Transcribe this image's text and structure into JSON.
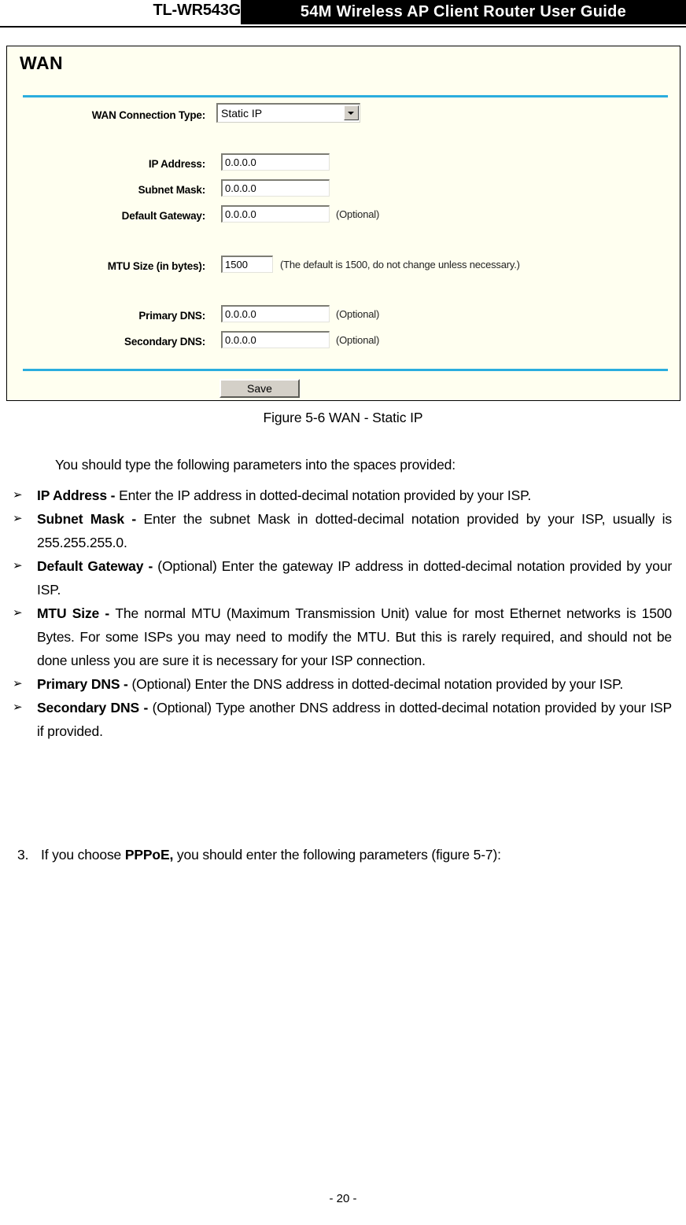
{
  "header": {
    "model": "TL-WR543G",
    "banner": "54M  Wireless  AP  Client  Router  User  Guide"
  },
  "figure": {
    "panel_title": "WAN",
    "accent_color": "#2badde",
    "panel_background": "#fffff0",
    "fields": [
      {
        "label": "WAN Connection Type:",
        "type": "select",
        "value": "Static IP",
        "hint": ""
      },
      {
        "label": "IP Address:",
        "type": "text",
        "value": "0.0.0.0",
        "hint": ""
      },
      {
        "label": "Subnet Mask:",
        "type": "text",
        "value": "0.0.0.0",
        "hint": ""
      },
      {
        "label": "Default Gateway:",
        "type": "text",
        "value": "0.0.0.0",
        "hint": "(Optional)"
      },
      {
        "label": "MTU Size (in bytes):",
        "type": "text",
        "value": "1500",
        "hint": "(The default is 1500, do not change unless necessary.)"
      },
      {
        "label": "Primary DNS:",
        "type": "text",
        "value": "0.0.0.0",
        "hint": "(Optional)"
      },
      {
        "label": "Secondary DNS:",
        "type": "text",
        "value": "0.0.0.0",
        "hint": "(Optional)"
      }
    ],
    "save_button": "Save",
    "caption": "Figure 5-6    WAN - Static IP"
  },
  "body": {
    "intro": "You should type the following parameters into the spaces provided:",
    "bullet_marker": "➢",
    "bullets": [
      {
        "term": "IP Address - ",
        "text": "Enter the IP address in dotted-decimal notation provided by your ISP."
      },
      {
        "term": "Subnet Mask - ",
        "text": "Enter the subnet Mask in dotted-decimal notation provided by your ISP, usually is 255.255.255.0."
      },
      {
        "term": "Default Gateway - ",
        "text": "(Optional) Enter the gateway IP address in dotted-decimal notation provided by your ISP."
      },
      {
        "term": "MTU Size - ",
        "text": "The normal MTU (Maximum Transmission Unit) value for most Ethernet networks is 1500 Bytes. For some ISPs you may need to modify the MTU. But this is rarely required, and should not be done unless you are sure it is necessary for your ISP connection."
      },
      {
        "term": "Primary DNS - ",
        "text": "(Optional) Enter the DNS address in dotted-decimal notation provided by your ISP."
      },
      {
        "term": "Secondary DNS - ",
        "text": "(Optional) Type another DNS address in dotted-decimal notation provided by your ISP if provided."
      }
    ],
    "numbered_step": {
      "number": "3.",
      "prefix": "If you choose ",
      "bold": "PPPoE,",
      "suffix": " you should enter the following parameters (figure 5-7):"
    }
  },
  "footer": {
    "page_number": "- 20 -"
  }
}
